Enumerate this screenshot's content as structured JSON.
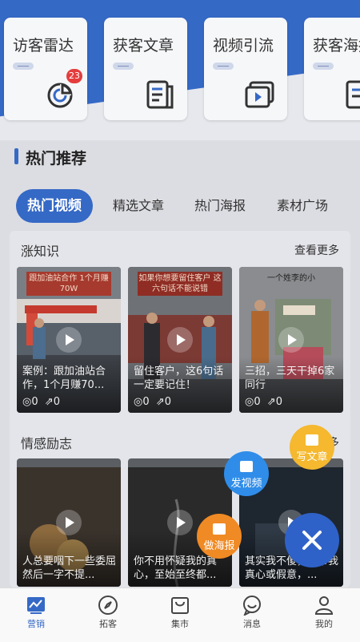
{
  "top_cards": [
    {
      "title": "访客雷达",
      "icon": "radar-chart-icon",
      "badge": "23"
    },
    {
      "title": "获客文章",
      "icon": "document-icon"
    },
    {
      "title": "视频引流",
      "icon": "video-play-icon"
    },
    {
      "title": "获客海报",
      "icon": "poster-icon"
    }
  ],
  "section": {
    "title": "热门推荐"
  },
  "tabs": [
    "热门视频",
    "精选文章",
    "热门海报",
    "素材广场"
  ],
  "groups": [
    {
      "title": "涨知识",
      "more": "查看更多",
      "items": [
        {
          "poster": "跟加油站合作 1个月赚70W",
          "title": "案例：跟加油站合作，1个月赚70...",
          "views": "0",
          "shares": "0"
        },
        {
          "poster": "如果你想要留住客户 这六句话不能说错",
          "title": "留住客户，这6句话一定要记住！",
          "views": "0",
          "shares": "0"
        },
        {
          "poster": "一个姓李的小",
          "title": "三招，三天干掉6家同行",
          "views": "0",
          "shares": "0"
        }
      ]
    },
    {
      "title": "情感励志",
      "more": "多",
      "items": [
        {
          "title": "人总要咽下一些委屈然后一字不提..."
        },
        {
          "title": "你不用怀疑我的真心，至始至终都..."
        },
        {
          "title": "其实我不傻，你带我真心或假意，..."
        }
      ]
    }
  ],
  "fabs": {
    "write_article": "写文章",
    "post_video": "发视频",
    "make_poster": "做海报"
  },
  "nav": [
    {
      "label": "营销",
      "icon": "chart-icon",
      "active": true
    },
    {
      "label": "拓客",
      "icon": "compass-icon"
    },
    {
      "label": "集市",
      "icon": "shopping-bag-icon"
    },
    {
      "label": "消息",
      "icon": "message-smile-icon"
    },
    {
      "label": "我的",
      "icon": "user-icon"
    }
  ],
  "colors": {
    "accent": "#3569c6",
    "badge": "#e53d3d",
    "fab_orange": "#f08a24",
    "fab_yellow": "#f5b82e",
    "fab_blue": "#2f8de9",
    "fab_close": "#2f62c8"
  }
}
